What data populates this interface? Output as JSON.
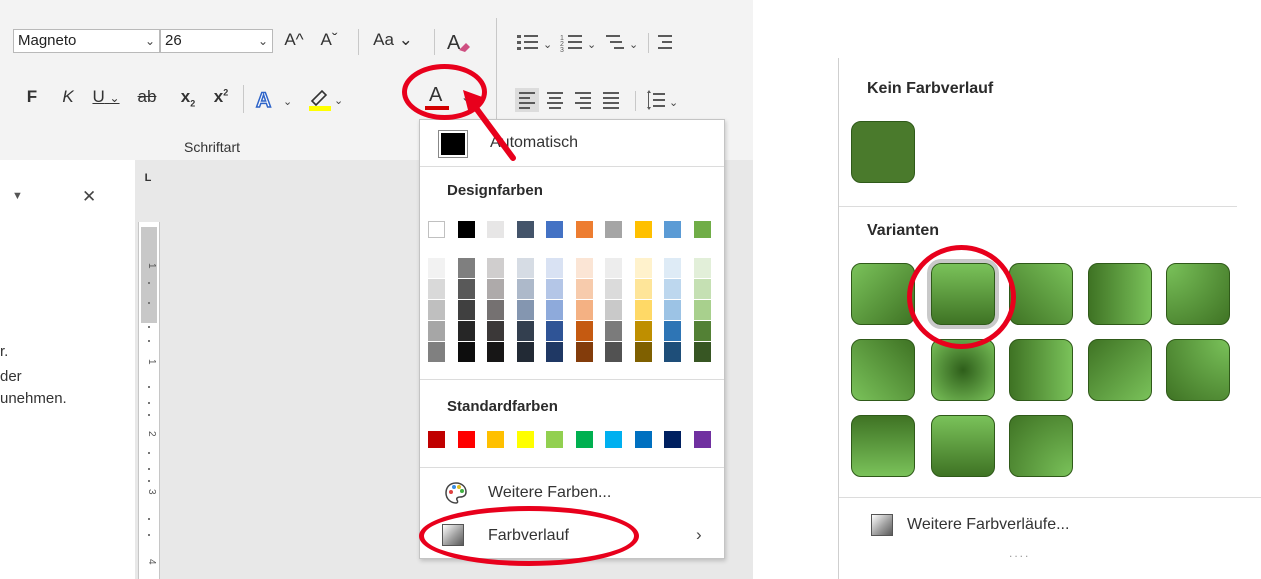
{
  "ribbon": {
    "font_name": "Magneto",
    "font_size": "26",
    "grow_font": "A^",
    "shrink_font": "Aˇ",
    "change_case": "Aa",
    "bold": "F",
    "italic": "K",
    "underline": "U",
    "strikethrough": "ab",
    "subscript": "x",
    "superscript": "x",
    "font_color_letter": "A",
    "group_label": "Schriftart"
  },
  "pane": {
    "line1": "r.",
    "line2": "der",
    "line3": "unehmen."
  },
  "color_menu": {
    "auto_label": "Automatisch",
    "design_header": "Designfarben",
    "standard_header": "Standardfarben",
    "more_colors": "Weitere Farben...",
    "gradient": "Farbverlauf",
    "theme_colors": [
      "#ffffff",
      "#000000",
      "#e7e6e6",
      "#44546a",
      "#4472c4",
      "#ed7d31",
      "#a5a5a5",
      "#ffc000",
      "#5b9bd5",
      "#70ad47"
    ],
    "tint_columns": [
      [
        "#f2f2f2",
        "#d9d9d9",
        "#bfbfbf",
        "#a6a6a6",
        "#808080"
      ],
      [
        "#7f7f7f",
        "#595959",
        "#404040",
        "#262626",
        "#0d0d0d"
      ],
      [
        "#d0cece",
        "#aeaaaa",
        "#757171",
        "#3b3838",
        "#171616"
      ],
      [
        "#d6dce4",
        "#adb9ca",
        "#8496b0",
        "#333f4f",
        "#222a35"
      ],
      [
        "#d9e2f3",
        "#b4c6e7",
        "#8eaadb",
        "#2f5496",
        "#1f3864"
      ],
      [
        "#fbe5d5",
        "#f7cbac",
        "#f4b183",
        "#c55a11",
        "#833c0b"
      ],
      [
        "#ededed",
        "#dbdbdb",
        "#c9c9c9",
        "#7b7b7b",
        "#525252"
      ],
      [
        "#fff2cc",
        "#fee599",
        "#ffd966",
        "#bf8f00",
        "#7f6000"
      ],
      [
        "#deebf6",
        "#bdd7ee",
        "#9cc3e5",
        "#2e75b5",
        "#1e4e79"
      ],
      [
        "#e2efd9",
        "#c5e0b3",
        "#a8d08d",
        "#538135",
        "#375623"
      ]
    ],
    "standard_colors": [
      "#c00000",
      "#ff0000",
      "#ffc000",
      "#ffff00",
      "#92d050",
      "#00b050",
      "#00b0f0",
      "#0070c0",
      "#002060",
      "#7030a0"
    ]
  },
  "gradient_menu": {
    "none_header": "Kein Farbverlauf",
    "variants_header": "Varianten",
    "more_gradients": "Weitere Farbverläufe...",
    "base_color": "#4a7a2c"
  }
}
